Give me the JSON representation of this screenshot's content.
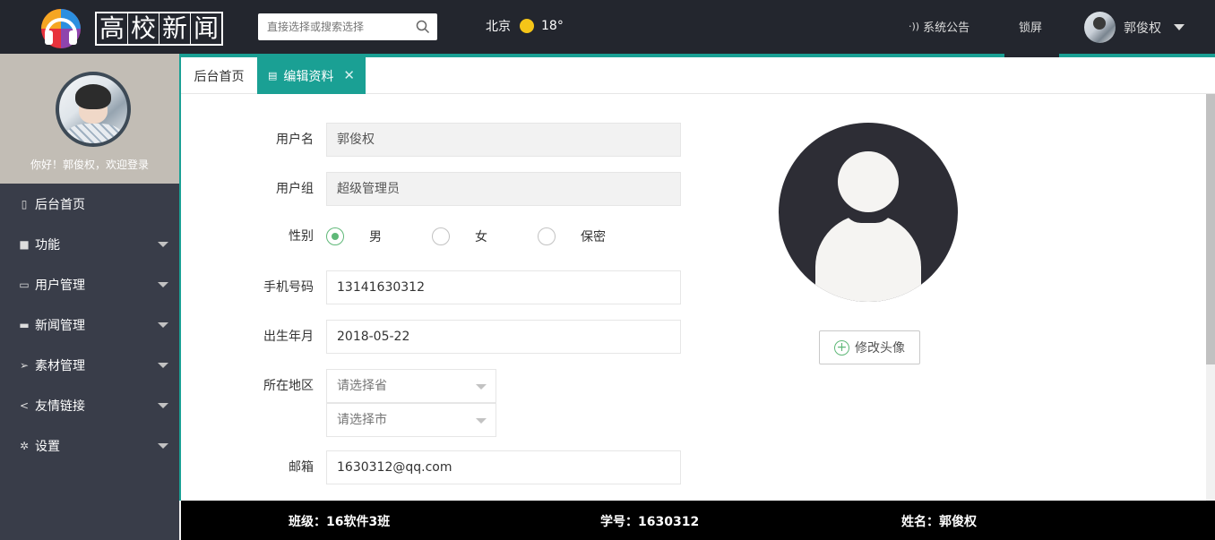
{
  "header": {
    "logo_chars": [
      "高",
      "校",
      "新",
      "闻"
    ],
    "search_placeholder": "直接选择或搜索选择",
    "weather_city": "北京",
    "weather_temp": "18°",
    "notice_label": "系统公告",
    "lock_label": "锁屏",
    "user_name": "郭俊权"
  },
  "sidebar": {
    "greeting": "你好！郭俊权，欢迎登录",
    "items": [
      {
        "label": "后台首页",
        "icon": "tablet-icon",
        "has_submenu": false
      },
      {
        "label": "功能",
        "icon": "briefcase-icon",
        "has_submenu": true
      },
      {
        "label": "用户管理",
        "icon": "chat-icon",
        "has_submenu": true
      },
      {
        "label": "新闻管理",
        "icon": "folder-icon",
        "has_submenu": true
      },
      {
        "label": "素材管理",
        "icon": "paper-plane-icon",
        "has_submenu": true
      },
      {
        "label": "友情链接",
        "icon": "share-icon",
        "has_submenu": true
      },
      {
        "label": "设置",
        "icon": "gear-icon",
        "has_submenu": true
      }
    ]
  },
  "tabs": [
    {
      "label": "后台首页",
      "active": false
    },
    {
      "label": "编辑资料",
      "active": true,
      "closable": true
    }
  ],
  "form": {
    "username_label": "用户名",
    "username_value": "郭俊权",
    "group_label": "用户组",
    "group_value": "超级管理员",
    "gender_label": "性别",
    "gender_options": [
      {
        "label": "男",
        "checked": true
      },
      {
        "label": "女",
        "checked": false
      },
      {
        "label": "保密",
        "checked": false
      }
    ],
    "phone_label": "手机号码",
    "phone_value": "13141630312",
    "birth_label": "出生年月",
    "birth_value": "2018-05-22",
    "region_label": "所在地区",
    "province_placeholder": "请选择省",
    "city_placeholder": "请选择市",
    "email_label": "邮箱",
    "email_value": "1630312@qq.com"
  },
  "avatar_panel": {
    "change_button_label": "修改头像"
  },
  "footer": {
    "class_info": "班级：16软件3班",
    "student_id": "学号：1630312",
    "name": "姓名：郭俊权"
  },
  "colors": {
    "header_bg": "#23262e",
    "sidebar_bg": "#393d49",
    "accent": "#1aa094",
    "radio_checked": "#5fb878"
  }
}
